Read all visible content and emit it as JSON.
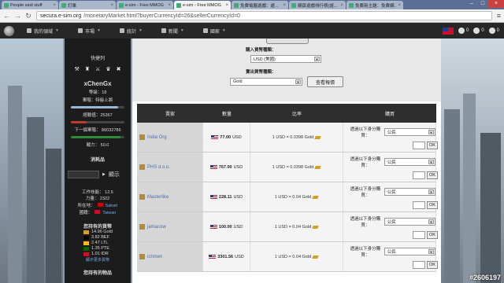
{
  "browser": {
    "tabs": [
      {
        "label": "People said stuff"
      },
      {
        "label": "訂單"
      },
      {
        "label": "e-sim - Free MMOG"
      },
      {
        "label": "e-sim - Free MMOG"
      },
      {
        "label": "免費電腦遊戲：遊..."
      },
      {
        "label": "網頁遊戲排行榜(遊..."
      },
      {
        "label": "免費新主題：免費網..."
      }
    ],
    "url_host": "secura.e-sim.org",
    "url_path": "/monetaryMarket.html?buyerCurrencyId=26&sellerCurrencyId=0"
  },
  "gamebar": {
    "nav": [
      {
        "label": "我的領域",
        "icon": "globe-icon"
      },
      {
        "label": "市場",
        "icon": "market-icon"
      },
      {
        "label": "統計",
        "icon": "chart-icon"
      },
      {
        "label": "新聞",
        "icon": "news-icon"
      },
      {
        "label": "國家",
        "icon": "flag-icon"
      }
    ],
    "counts": [
      "0",
      "0",
      "0"
    ]
  },
  "sidebar": {
    "shortcuts_label": "快捷列",
    "name": "xChenGx",
    "level_line": "等級：18",
    "rank_line": "軍階：特級上將",
    "xp_line": "經驗值：25367",
    "next_rank_line": "下一個軍階： 86032786",
    "strength_line": "戰力： 50.0",
    "consume_label": "消耗品",
    "show_label": "顯示",
    "work_skill": "工作技能： 12.5",
    "strength": "力量： 2322",
    "location_label": "所在地：",
    "location_value": "Sabah",
    "citizenship_label": "國籍：",
    "citizenship_value": "Taiwan",
    "money_title": "您持有的貨幣",
    "money": [
      {
        "amount": "14.96 Gold",
        "color": "#d4a020"
      },
      {
        "amount": "3.82 BEF",
        "color": "#000000"
      },
      {
        "amount": "2.47 LTL",
        "color": "#fdb913"
      },
      {
        "amount": "1.35 PTE",
        "color": "#006600"
      },
      {
        "amount": "1.01 IDR",
        "color": "#ce1126"
      }
    ],
    "money_more": "顯示更多貨幣",
    "inventory_title": "您持有的物品"
  },
  "form": {
    "buy_label": "購入貨幣種類：",
    "buy_value": "USD (美國)",
    "sell_label": "賣出貨幣種類：",
    "sell_value": "Gold",
    "view_button": "查看報價"
  },
  "table": {
    "headers": [
      "賣家",
      "數量",
      "比率",
      "購買"
    ],
    "buy_label": "透過以下身分購買：",
    "buy_as": "公民",
    "ok": "OK",
    "rows": [
      {
        "seller": "India Org",
        "amount": "77.00",
        "cur": "USD",
        "rate": "1 USD = 0.0398 Gold"
      },
      {
        "seller": "PHS d.o.o.",
        "amount": "767.00",
        "cur": "USD",
        "rate": "1 USD = 0.0398 Gold"
      },
      {
        "seller": "Masterlike",
        "amount": "228.11",
        "cur": "USD",
        "rate": "1 USD = 0.04 Gold"
      },
      {
        "seller": "jamacow",
        "amount": "100.00",
        "cur": "USD",
        "rate": "1 USD = 0.04 Gold"
      },
      {
        "seller": "ichmen",
        "amount": "3301.56",
        "cur": "USD",
        "rate": "1 USD = 0.04 Gold"
      }
    ]
  },
  "watermark": "#2606197"
}
